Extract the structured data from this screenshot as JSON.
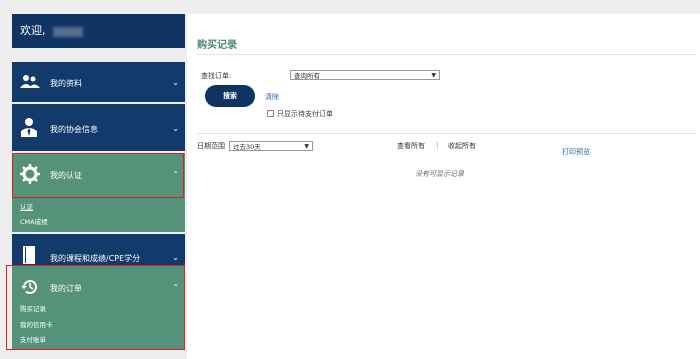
{
  "sidebar": {
    "welcome": "欢迎,",
    "items": [
      {
        "label": "我的资料",
        "chevron": "⌄"
      },
      {
        "label": "我的协会信息",
        "chevron": "⌄"
      },
      {
        "label": "我的认证",
        "chevron": "⌃",
        "subitems": [
          "认证",
          "CMA成绩"
        ]
      },
      {
        "label": "我的课程和成绩/CPE学分",
        "chevron": "⌄"
      },
      {
        "label": "我的订单",
        "chevron": "⌃",
        "subitems": [
          "购买记录",
          "我的信用卡",
          "支付账单"
        ]
      }
    ]
  },
  "main": {
    "title": "购买记录",
    "search_label": "查找订单:",
    "search_select": "查询所有",
    "search_button": "搜索",
    "clear_link": "清除",
    "checkbox_label": "只显示待支付订单",
    "date_label": "日期范围",
    "date_select": "过去30天",
    "view_all": "查看所有",
    "separator": "|",
    "collapse_all": "收起所有",
    "print_preview": "打印预览",
    "empty_message": "没有可显示记录"
  },
  "colors": {
    "sidebar_navy": "#123a6b",
    "active_green": "#54937a",
    "highlight_red": "#e02020",
    "title_green": "#4a8c6e"
  }
}
